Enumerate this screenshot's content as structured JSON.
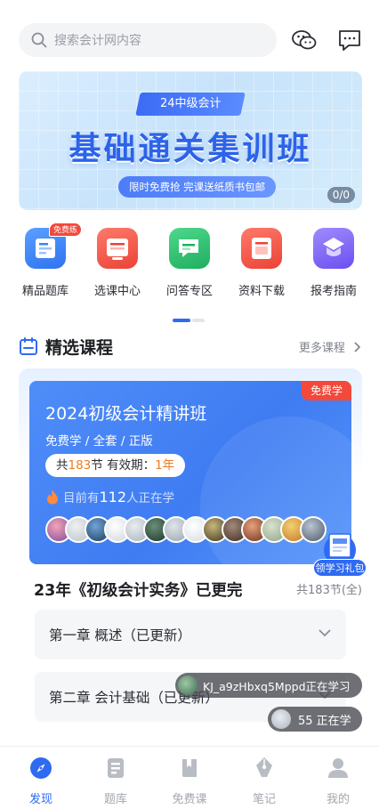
{
  "search": {
    "placeholder": "搜索会计网内容"
  },
  "top_icons": [
    "wechat-icon",
    "message-icon"
  ],
  "banner": {
    "tag": "24中级会计",
    "title": "基础通关集训班",
    "subtitle": "限时免费抢 完课送纸质书包邮",
    "counter": "0/0"
  },
  "quick_nav": [
    {
      "label": "精品题库",
      "icon": "question-bank-icon",
      "badge": "免费练",
      "color": "#3b82f6"
    },
    {
      "label": "选课中心",
      "icon": "course-center-icon",
      "color": "#f0554a"
    },
    {
      "label": "问答专区",
      "icon": "qa-icon",
      "color": "#2fbf71"
    },
    {
      "label": "资料下载",
      "icon": "download-icon",
      "color": "#f0554a"
    },
    {
      "label": "报考指南",
      "icon": "guide-icon",
      "color": "#7a5cf0"
    }
  ],
  "section": {
    "title": "精选课程",
    "more": "更多课程"
  },
  "course": {
    "free_tag": "免费学",
    "title": "2024初级会计精讲班",
    "subtitle": "免费学 / 全套 / 正版",
    "lessons_prefix": "共",
    "lessons": "183",
    "lessons_suffix": "节 有效期：",
    "validity": "1年",
    "studying_prefix": "目前有",
    "studying_count": "112",
    "studying_suffix": "人正在学",
    "gift_label": "领学习礼包",
    "name": "23年《初级会计实务》已更完",
    "count": "共183节(全)"
  },
  "chapters": [
    {
      "label": "第一章  概述（已更新）"
    },
    {
      "label": "第二章  会计基础（已更新）"
    }
  ],
  "floating": {
    "user": "KJ_a9zHbxq5Mppd正在学习",
    "learners": "55 正在学"
  },
  "tabs": [
    {
      "label": "发现",
      "active": true
    },
    {
      "label": "题库"
    },
    {
      "label": "免费课"
    },
    {
      "label": "笔记"
    },
    {
      "label": "我的"
    }
  ],
  "colors": {
    "accent": "#2f6bf2",
    "red": "#f2493b",
    "orange": "#f07b1d"
  }
}
